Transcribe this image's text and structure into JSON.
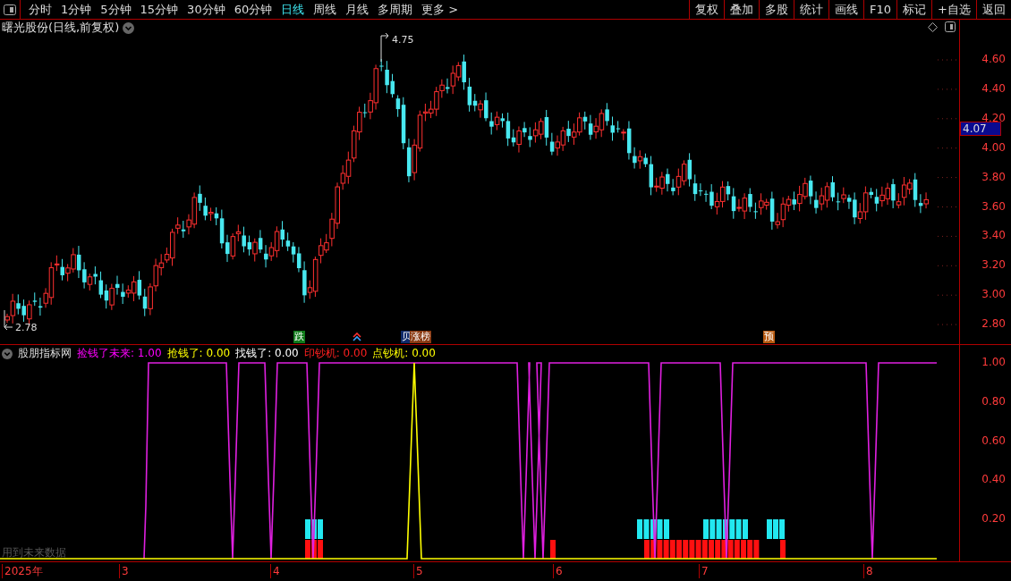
{
  "toolbar": {
    "periods": [
      {
        "label": "分时",
        "selected": false
      },
      {
        "label": "1分钟",
        "selected": false
      },
      {
        "label": "5分钟",
        "selected": false
      },
      {
        "label": "15分钟",
        "selected": false
      },
      {
        "label": "30分钟",
        "selected": false
      },
      {
        "label": "60分钟",
        "selected": false
      },
      {
        "label": "日线",
        "selected": true
      },
      {
        "label": "周线",
        "selected": false
      },
      {
        "label": "月线",
        "selected": false
      },
      {
        "label": "多周期",
        "selected": false
      }
    ],
    "more": "更多 >",
    "actions": [
      "复权",
      "叠加",
      "多股",
      "统计",
      "画线",
      "F10",
      "标记",
      "+自选",
      "返回"
    ]
  },
  "price_chart": {
    "title": "曙光股份(日线,前复权)",
    "high_label": "4.75",
    "low_label": "2.78",
    "axis_labels": [
      "4.60",
      "4.40",
      "4.20",
      "4.00",
      "3.80",
      "3.60",
      "3.40",
      "3.20",
      "3.00",
      "2.80"
    ],
    "current_price": "4.07",
    "signals": [
      {
        "kind": "text",
        "text": "跌",
        "color": "#0f7a1a"
      },
      {
        "kind": "arrow"
      },
      {
        "kind": "text",
        "text": "贝",
        "color": "#102a6a"
      },
      {
        "kind": "text",
        "text": "涨榜",
        "color": "#8a3a12"
      },
      {
        "kind": "text",
        "text": "预",
        "color": "#b85a10"
      }
    ]
  },
  "indicator": {
    "name": "股朋指标网",
    "legend": [
      {
        "text": "捡钱了未来: 1.00"
      },
      {
        "text": "抢钱了: 0.00"
      },
      {
        "text": "找钱了: 0.00"
      },
      {
        "text": "印钞机: 0.00"
      },
      {
        "text": "点钞机: 0.00"
      }
    ],
    "axis_labels": [
      "1.00",
      "0.80",
      "0.60",
      "0.40",
      "0.20"
    ],
    "note": "用到未来数据"
  },
  "date_axis": [
    "2025年",
    "3",
    "4",
    "5",
    "6",
    "7",
    "8"
  ]
}
